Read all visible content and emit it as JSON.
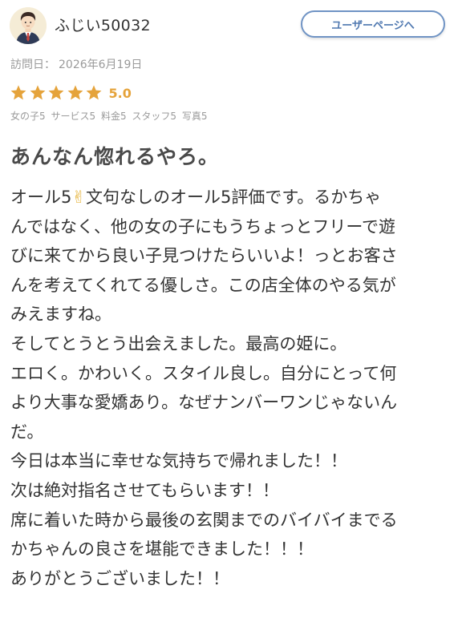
{
  "user": {
    "name": "ふじい50032",
    "page_button_label": "ユーザーページへ"
  },
  "visit": {
    "label": "訪問日：",
    "date": "2026年6月19日"
  },
  "rating": {
    "stars": 5,
    "max_stars": 5,
    "score": "5.0",
    "star_color": "#e5a33b",
    "breakdown": [
      "女の子5",
      "サービス5",
      "料金5",
      "スタッフ5",
      "写真5"
    ]
  },
  "review": {
    "title": "あんなん惚れるやろ。",
    "lines": [
      {
        "pre": "オール5",
        "emoji": "✌",
        "post": "文句なしのオール5評価です。るかちゃ"
      },
      {
        "pre": "んではなく、他の女の子にもうちょっとフリーで遊",
        "emoji": "",
        "post": ""
      },
      {
        "pre": "びに来てから良い子見つけたらいいよ！っとお客さ",
        "emoji": "",
        "post": ""
      },
      {
        "pre": "んを考えてくれてる優しさ。この店全体のやる気が",
        "emoji": "",
        "post": ""
      },
      {
        "pre": "みえますね。",
        "emoji": "",
        "post": ""
      },
      {
        "pre": "そしてとうとう出会えました。最高の姫に。",
        "emoji": "",
        "post": ""
      },
      {
        "pre": "エロく。かわいく。スタイル良し。自分にとって何",
        "emoji": "",
        "post": ""
      },
      {
        "pre": "より大事な愛嬌あり。なぜナンバーワンじゃないん",
        "emoji": "",
        "post": ""
      },
      {
        "pre": "だ。",
        "emoji": "",
        "post": ""
      },
      {
        "pre": "今日は本当に幸せな気持ちで帰れました！！",
        "emoji": "",
        "post": ""
      },
      {
        "pre": "次は絶対指名させてもらいます！！",
        "emoji": "",
        "post": ""
      },
      {
        "pre": "席に着いた時から最後の玄関までのバイバイまでる",
        "emoji": "",
        "post": ""
      },
      {
        "pre": "かちゃんの良さを堪能できました！！！",
        "emoji": "",
        "post": ""
      },
      {
        "pre": "ありがとうございました！！",
        "emoji": "",
        "post": ""
      }
    ]
  },
  "colors": {
    "accent_button": "#6f93c4",
    "star": "#e5a33b"
  }
}
